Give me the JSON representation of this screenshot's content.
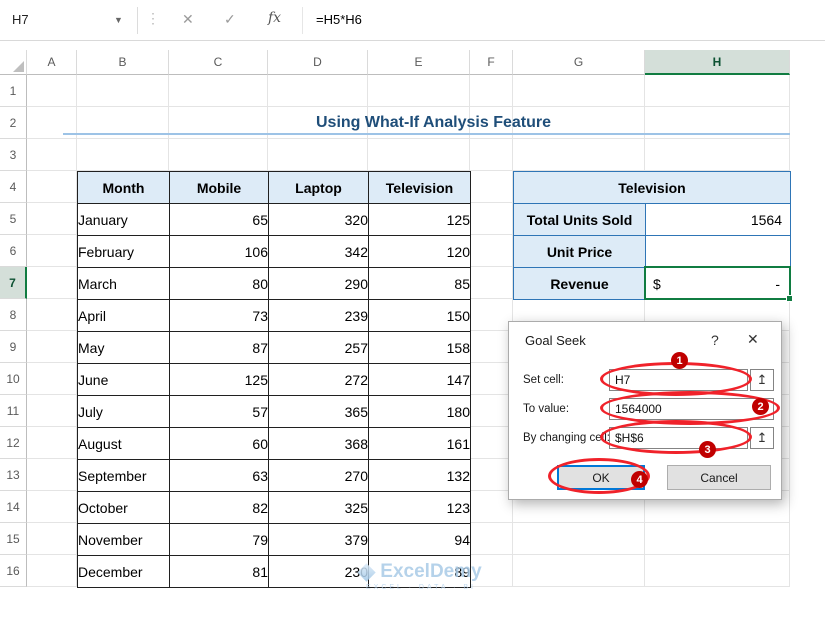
{
  "formula_bar": {
    "name_box": "H7",
    "dropdown_icon": "▼",
    "dots_icon": "⋮",
    "cancel_icon": "✕",
    "enter_icon": "✓",
    "fx_icon": "fx",
    "formula": "=H5*H6"
  },
  "grid": {
    "col_headers": [
      "A",
      "B",
      "C",
      "D",
      "E",
      "F",
      "G",
      "H"
    ],
    "row_headers": [
      "1",
      "2",
      "3",
      "4",
      "5",
      "6",
      "7",
      "8",
      "9",
      "10",
      "11",
      "12",
      "13",
      "14",
      "15",
      "16"
    ],
    "selected_cell": "H7"
  },
  "title": {
    "text": "Using What-If Analysis Feature"
  },
  "sales_table": {
    "headers": [
      "Month",
      "Mobile",
      "Laptop",
      "Television"
    ],
    "rows": [
      [
        "January",
        "65",
        "320",
        "125"
      ],
      [
        "February",
        "106",
        "342",
        "120"
      ],
      [
        "March",
        "80",
        "290",
        "85"
      ],
      [
        "April",
        "73",
        "239",
        "150"
      ],
      [
        "May",
        "87",
        "257",
        "158"
      ],
      [
        "June",
        "125",
        "272",
        "147"
      ],
      [
        "July",
        "57",
        "365",
        "180"
      ],
      [
        "August",
        "60",
        "368",
        "161"
      ],
      [
        "September",
        "63",
        "270",
        "132"
      ],
      [
        "October",
        "82",
        "325",
        "123"
      ],
      [
        "November",
        "79",
        "379",
        "94"
      ],
      [
        "December",
        "81",
        "230",
        "89"
      ]
    ]
  },
  "summary_table": {
    "title": "Television",
    "row1_label": "Total Units Sold",
    "row1_value": "1564",
    "row2_label": "Unit Price",
    "row2_value": "",
    "row3_label": "Revenue",
    "row3_currency": "$",
    "row3_amount": "-"
  },
  "goal_seek": {
    "title": "Goal Seek",
    "help_icon": "?",
    "close_icon": "✕",
    "set_cell_label": "Set cell:",
    "set_cell_value": "H7",
    "to_value_label": "To value:",
    "to_value_value": "1564000",
    "by_changing_label": "By changing cell:",
    "by_changing_value": "$H$6",
    "picker_icon": "↥",
    "ok_label": "OK",
    "cancel_label": "Cancel",
    "badge_1": "1",
    "badge_2": "2",
    "badge_3": "3",
    "badge_4": "4"
  },
  "watermark": {
    "brand": "ExcelDemy",
    "tagline": "EXCEL · DATA · BI"
  },
  "colors": {
    "selection_green": "#107C41",
    "header_fill": "#DDEBF7",
    "summary_border": "#2E75B6",
    "title_text": "#1F4E79",
    "annotation_red": "#F0222A",
    "badge_red": "#C00000",
    "default_button_blue": "#0078D7",
    "watermark_blue": "#A9CBE7"
  }
}
